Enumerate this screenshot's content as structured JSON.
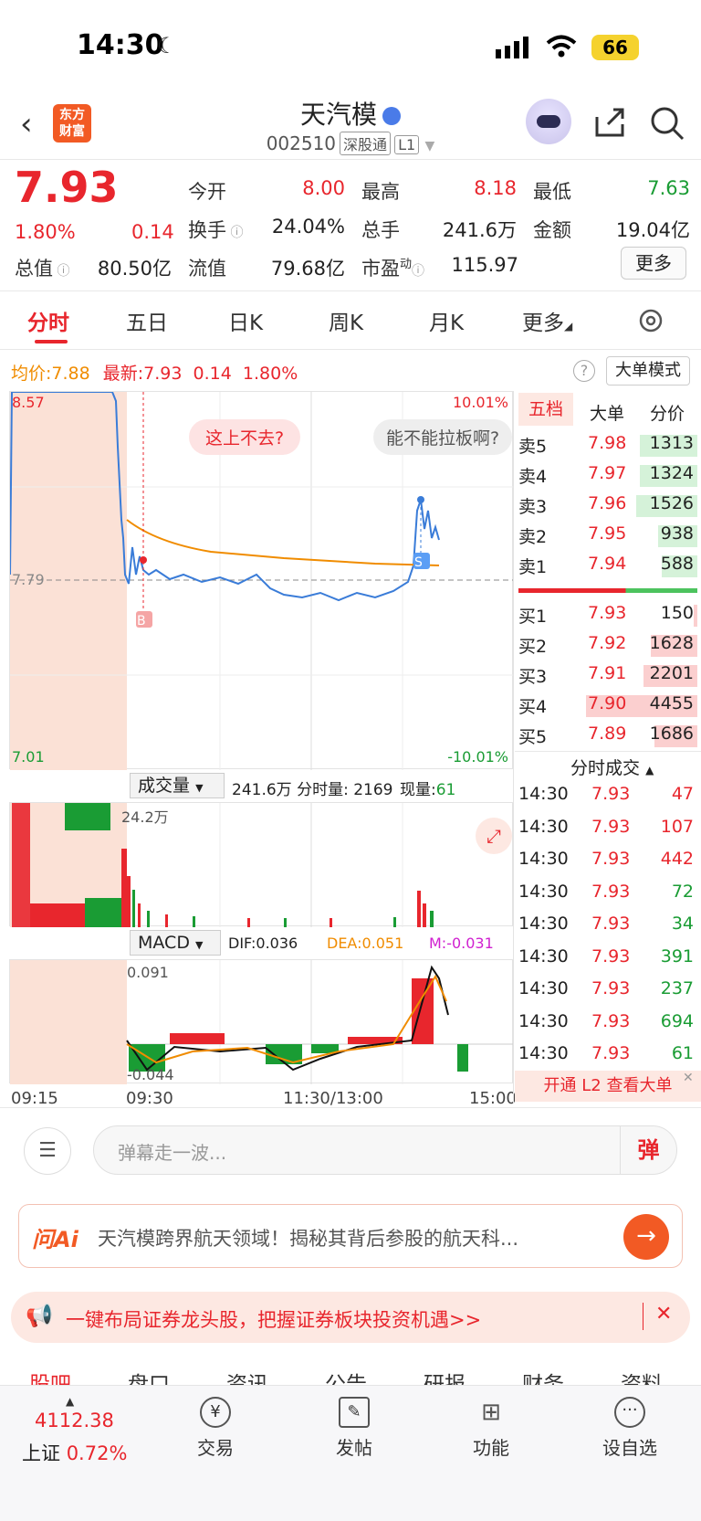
{
  "status": {
    "time": "14:30",
    "battery": "66"
  },
  "header": {
    "title": "天汽模",
    "code": "002510",
    "tag1": "深股通",
    "tag2": "L1",
    "logo_line1": "东方",
    "logo_line2": "财富"
  },
  "quote": {
    "price": "7.93",
    "pct": "1.80%",
    "chg": "0.14",
    "today_open_label": "今开",
    "today_open": "8.00",
    "high_label": "最高",
    "high": "8.18",
    "low_label": "最低",
    "low": "7.63",
    "turnover_label": "换手",
    "turnover": "24.04%",
    "volume_label": "总手",
    "volume": "241.6万",
    "amount_label": "金额",
    "amount": "19.04亿",
    "mcap_label": "总值",
    "mcap": "80.50亿",
    "float_label": "流值",
    "float": "79.68亿",
    "pe_label": "市盈",
    "pe_sup": "动",
    "pe": "115.97",
    "more": "更多"
  },
  "tabs": [
    "分时",
    "五日",
    "日K",
    "周K",
    "月K",
    "更多"
  ],
  "chart_info": {
    "avg_label": "均价:",
    "avg": "7.88",
    "last_label": "最新:",
    "last": "7.93",
    "chg": "0.14",
    "pct": "1.80%",
    "big_mode": "大单模式"
  },
  "chart": {
    "y_top": "8.57",
    "y_mid": "7.79",
    "y_bot": "7.01",
    "pct_top": "10.01%",
    "pct_bot": "-10.01%",
    "bubble1": "这上不去?",
    "bubble2": "能不能拉板啊?",
    "marker_b": "B",
    "marker_s": "S",
    "vol_label": "成交量",
    "vol_info": "241.6万 分时量: 2169",
    "vol_now_label": "现量:",
    "vol_now": "61",
    "vol_max": "24.2万",
    "macd_label": "MACD",
    "dif": "DIF:0.036",
    "dea": "DEA:0.051",
    "m": "M:-0.031",
    "macd_top": "0.091",
    "macd_bot": "-0.044",
    "t0": "09:15",
    "t1": "09:30",
    "t2": "11:30/13:00",
    "t3": "15:00"
  },
  "orderbook": {
    "tabs": [
      "五档",
      "大单",
      "分价"
    ],
    "asks": [
      {
        "label": "卖5",
        "price": "7.98",
        "vol": "1313"
      },
      {
        "label": "卖4",
        "price": "7.97",
        "vol": "1324"
      },
      {
        "label": "卖3",
        "price": "7.96",
        "vol": "1526"
      },
      {
        "label": "卖2",
        "price": "7.95",
        "vol": "938"
      },
      {
        "label": "卖1",
        "price": "7.94",
        "vol": "588"
      }
    ],
    "bids": [
      {
        "label": "买1",
        "price": "7.93",
        "vol": "150"
      },
      {
        "label": "买2",
        "price": "7.92",
        "vol": "1628"
      },
      {
        "label": "买3",
        "price": "7.91",
        "vol": "2201"
      },
      {
        "label": "买4",
        "price": "7.90",
        "vol": "4455"
      },
      {
        "label": "买5",
        "price": "7.89",
        "vol": "1686"
      }
    ],
    "trades_title": "分时成交",
    "trades": [
      {
        "t": "14:30",
        "p": "7.93",
        "v": "47",
        "c": "red"
      },
      {
        "t": "14:30",
        "p": "7.93",
        "v": "107",
        "c": "red"
      },
      {
        "t": "14:30",
        "p": "7.93",
        "v": "442",
        "c": "red"
      },
      {
        "t": "14:30",
        "p": "7.93",
        "v": "72",
        "c": "green"
      },
      {
        "t": "14:30",
        "p": "7.93",
        "v": "34",
        "c": "green"
      },
      {
        "t": "14:30",
        "p": "7.93",
        "v": "391",
        "c": "green"
      },
      {
        "t": "14:30",
        "p": "7.93",
        "v": "237",
        "c": "green"
      },
      {
        "t": "14:30",
        "p": "7.93",
        "v": "694",
        "c": "green"
      },
      {
        "t": "14:30",
        "p": "7.93",
        "v": "61",
        "c": "green"
      }
    ],
    "l2": "开通 L2 查看大单"
  },
  "danmu_placeholder": "弹幕走一波...",
  "danmu_btn": "弹",
  "ai": {
    "logo": "问Ai",
    "text": "天汽模跨界航天领域！揭秘其背后参股的航天科..."
  },
  "banner": "一键布局证券龙头股，把握证券板块投资机遇>>",
  "subtabs": [
    "股吧",
    "盘口",
    "资讯",
    "公告",
    "研报",
    "财务",
    "资料"
  ],
  "bottom": {
    "index_val": "4112.38",
    "index_name": "上证",
    "index_pct": "0.72%",
    "trade": "交易",
    "post": "发帖",
    "func": "功能",
    "watch": "设自选"
  }
}
